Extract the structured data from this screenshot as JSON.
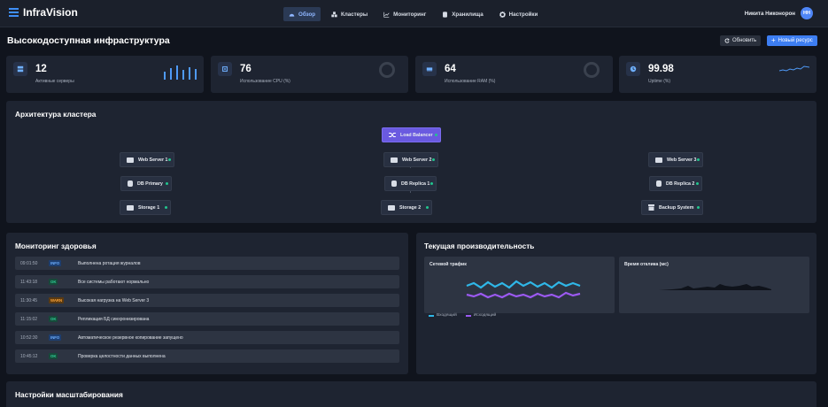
{
  "app": {
    "name": "InfraVision"
  },
  "nav": [
    {
      "label": "Обзор",
      "icon": "dashboard-icon",
      "active": true
    },
    {
      "label": "Кластеры",
      "icon": "cubes-icon",
      "active": false
    },
    {
      "label": "Мониторинг",
      "icon": "chart-line-icon",
      "active": false
    },
    {
      "label": "Хранилища",
      "icon": "database-icon",
      "active": false
    },
    {
      "label": "Настройки",
      "icon": "gear-icon",
      "active": false
    }
  ],
  "user": {
    "name": "Никита Никонорон",
    "initials": "НН"
  },
  "page": {
    "title": "Высокодоступная инфраструктура",
    "refresh_label": "Обновить",
    "add_label": "Новый ресурс"
  },
  "stats": [
    {
      "value": "12",
      "label": "Активные серверы",
      "icon": "server-icon",
      "viz": "bars"
    },
    {
      "value": "76",
      "label": "Использование CPU (%)",
      "icon": "cpu-icon",
      "viz": "ring"
    },
    {
      "value": "64",
      "label": "Использование RAM (%)",
      "icon": "memory-icon",
      "viz": "ring"
    },
    {
      "value": "99.98",
      "label": "Uptime (%)",
      "icon": "clock-icon",
      "viz": "sparkline"
    }
  ],
  "architecture": {
    "title": "Архитектура кластера",
    "load_balancer": "Load Balancer",
    "nodes": {
      "web1": "Web Server 1",
      "web2": "Web Server 2",
      "web3": "Web Server 3",
      "db_primary": "DB Primary",
      "db_replica1": "DB Replica 1",
      "db_replica2": "DB Replica 2",
      "storage1": "Storage 1",
      "storage2": "Storage 2",
      "backup": "Backup System"
    }
  },
  "health": {
    "title": "Мониторинг здоровья",
    "rows": [
      {
        "time": "09:01:50",
        "level": "INFO",
        "message": "Выполнена ротация журналов"
      },
      {
        "time": "11:43:18",
        "level": "OK",
        "message": "Все системы работают нормально"
      },
      {
        "time": "11:30:45",
        "level": "WARN",
        "message": "Высокая нагрузка на Web Server 3"
      },
      {
        "time": "11:15:02",
        "level": "OK",
        "message": "Репликация БД синхронизирована"
      },
      {
        "time": "10:52:30",
        "level": "INFO",
        "message": "Автоматическое резервное копирование запущено"
      },
      {
        "time": "10:45:12",
        "level": "OK",
        "message": "Проверка целостности данных выполнена"
      }
    ]
  },
  "performance": {
    "title": "Текущая производительность",
    "traffic_title": "Сетевой трафик",
    "response_title": "Время отклика (мс)",
    "legend_in": "Входящий",
    "legend_out": "Исходящий",
    "colors": {
      "incoming": "#2fb7e8",
      "outgoing": "#9b59f0"
    }
  },
  "scaling": {
    "title": "Настройки масштабирования"
  }
}
